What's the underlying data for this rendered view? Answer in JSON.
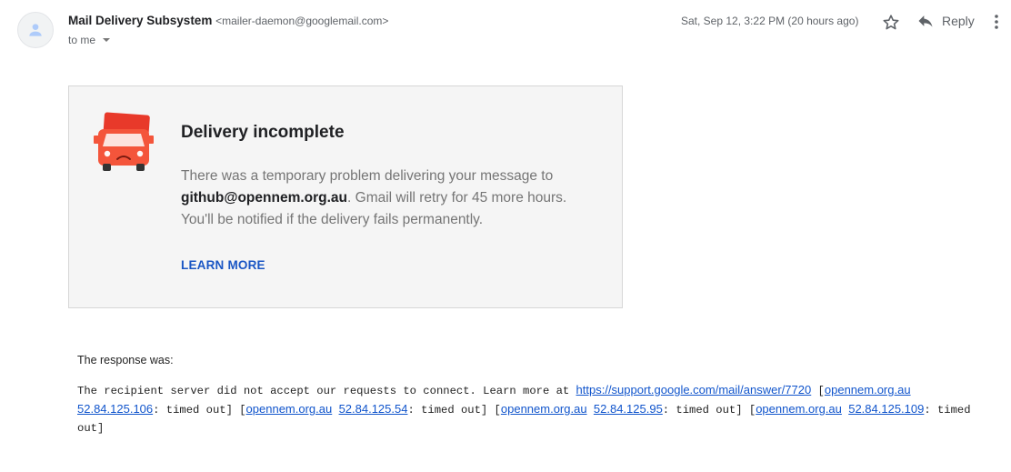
{
  "header": {
    "sender_name": "Mail Delivery Subsystem",
    "sender_email": "<mailer-daemon@googlemail.com>",
    "to_label": "to me",
    "date": "Sat, Sep 12, 3:22 PM (20 hours ago)",
    "reply_label": "Reply",
    "icons": {
      "avatar": "person-icon",
      "star": "star-outline-icon",
      "reply": "reply-arrow-icon",
      "more": "more-vertical-icon"
    }
  },
  "card": {
    "title": "Delivery incomplete",
    "text_before": "There was a temporary problem delivering your message to ",
    "recipient": "github@opennem.org.au",
    "text_after": ". Gmail will retry for 45 more hours. You'll be notified if the delivery fails permanently.",
    "learn_more": "LEARN MORE",
    "icon": "sad-truck-icon"
  },
  "response": {
    "label": "The response was:",
    "intro": "The recipient server did not accept our requests to connect. Learn more at ",
    "help_link": "https://support.google.com/mail/answer/7720",
    "entries": [
      {
        "host": "opennem.org.au",
        "ip": "52.84.125.106",
        "status": ": timed out]"
      },
      {
        "host": "opennem.org.au",
        "ip": "52.84.125.54",
        "status": ": timed out]"
      },
      {
        "host": "opennem.org.au",
        "ip": "52.84.125.95",
        "status": ": timed out]"
      },
      {
        "host": "opennem.org.au",
        "ip": "52.84.125.109",
        "status": ": timed out]"
      }
    ]
  },
  "colors": {
    "accent_link": "#1a56c4",
    "truck": "#f4553b"
  }
}
